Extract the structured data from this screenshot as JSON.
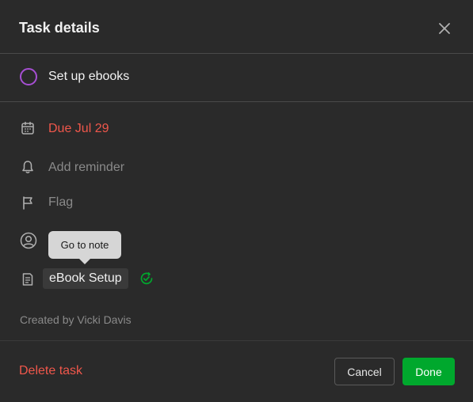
{
  "dialog": {
    "title": "Task details"
  },
  "task": {
    "name": "Set up ebooks",
    "checkbox_color": "#a64fd3"
  },
  "fields": {
    "due": {
      "icon": "calendar-icon",
      "label": "Due Jul 29",
      "color": "#f0574b"
    },
    "reminder": {
      "icon": "bell-icon",
      "label": "Add reminder"
    },
    "flag": {
      "icon": "flag-icon",
      "label": "Flag"
    },
    "assignee": {
      "icon": "user-circle-icon",
      "label": ""
    },
    "note": {
      "icon": "note-icon",
      "label": "eBook Setup",
      "status_icon": "sync-check-icon"
    }
  },
  "tooltip": {
    "text": "Go to note"
  },
  "meta": {
    "created_by": "Created by Vicki Davis"
  },
  "footer": {
    "delete_label": "Delete task",
    "cancel_label": "Cancel",
    "done_label": "Done"
  },
  "colors": {
    "accent_green": "#00a82d",
    "danger_red": "#f0574b",
    "background": "#2a2a2a"
  }
}
